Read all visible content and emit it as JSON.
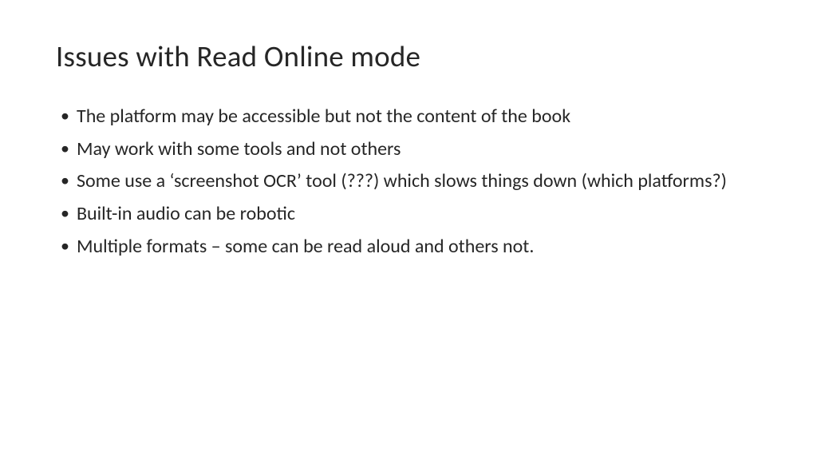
{
  "slide": {
    "title": "Issues with Read Online mode",
    "bullets": [
      "The platform may be accessible but not the content of the book",
      "May work with some tools and not others",
      "Some use a ‘screenshot OCR’ tool (???) which slows things down (which platforms?)",
      "Built-in audio can be robotic",
      "Multiple formats – some can be read aloud and others not."
    ]
  }
}
